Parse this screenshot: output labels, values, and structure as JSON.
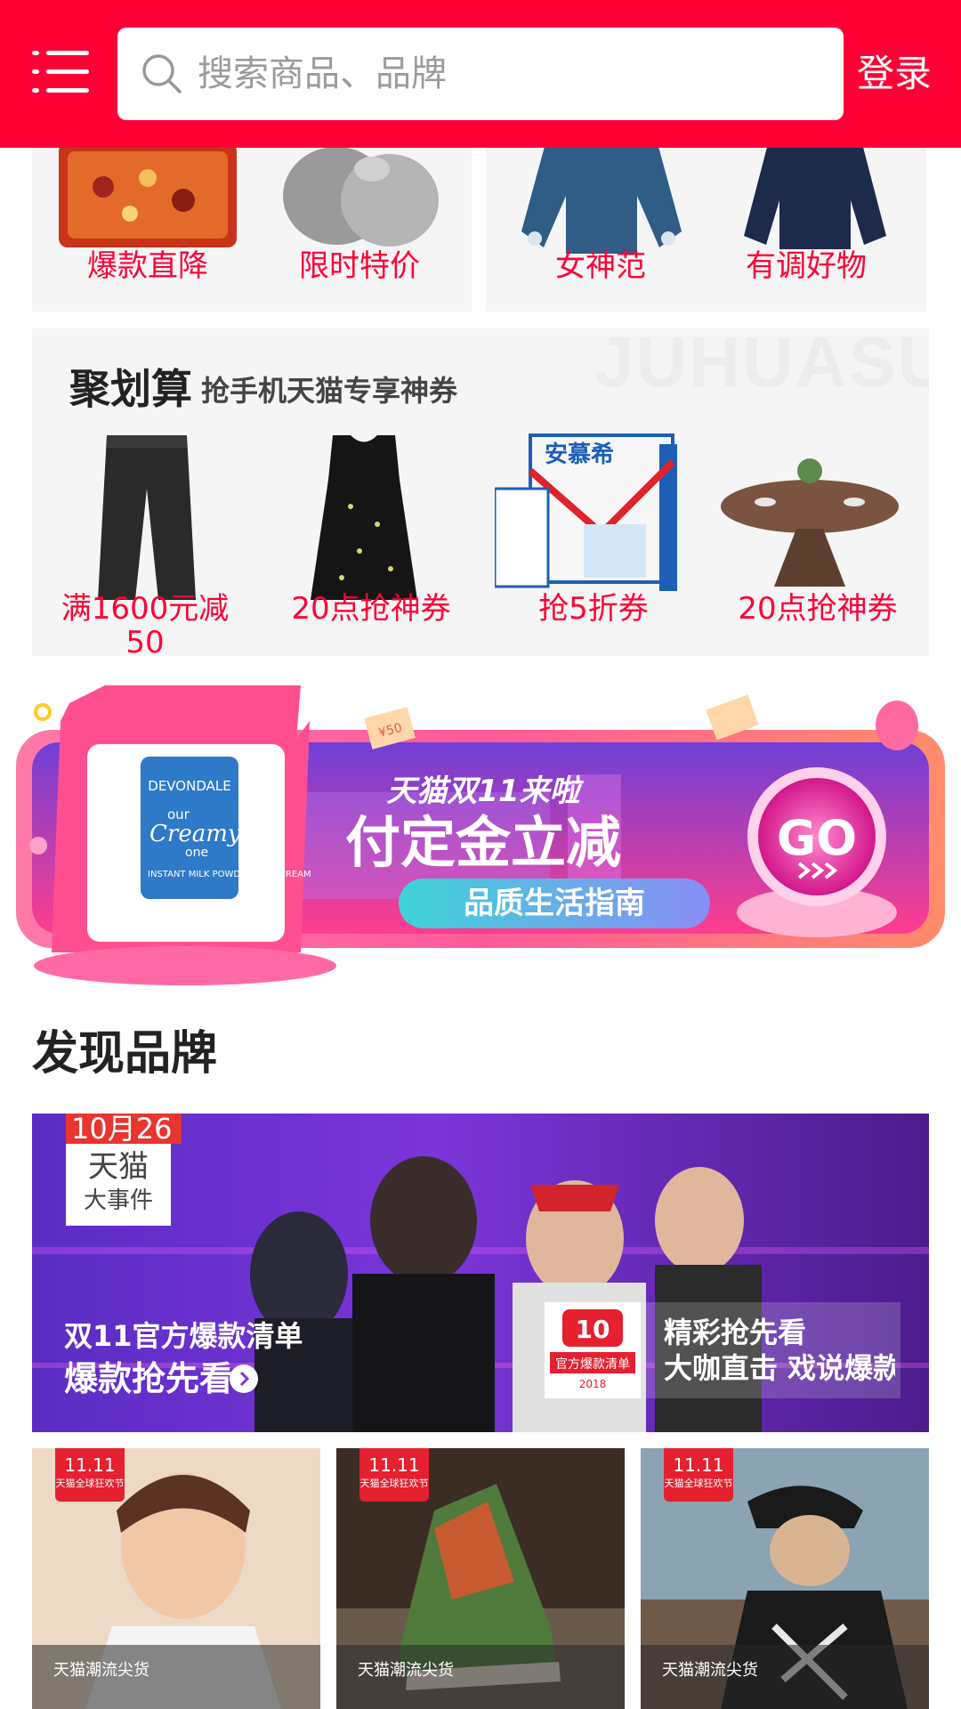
{
  "header": {
    "search_placeholder": "搜索商品、品牌",
    "login_label": "登录"
  },
  "top_cards": {
    "left": [
      "爆款直降",
      "限时特价"
    ],
    "right": [
      "女神范",
      "有调好物"
    ]
  },
  "juhuasuan": {
    "watermark": "JUHUASUAN",
    "title": "聚划算",
    "subtitle": "抢手机天猫专享神券",
    "items": [
      {
        "label": "满1600元减50"
      },
      {
        "label": "20点抢神券"
      },
      {
        "label": "抢5折券",
        "product_text": "安慕希"
      },
      {
        "label": "20点抢神券"
      }
    ]
  },
  "promo_banner": {
    "headline_small": "天猫双11来啦",
    "headline_big": "付定金立减",
    "pill": "品质生活指南",
    "go": "GO",
    "coupon": "¥50",
    "product_brand": "DEVONDALE",
    "product_name_1": "our",
    "product_name_2": "Creamy",
    "product_name_3": "one",
    "product_desc": "INSTANT MILK POWDER FULL CREAM"
  },
  "discover": {
    "title": "发现品牌",
    "banner": {
      "date": "10月26",
      "tag_line1": "天猫",
      "tag_line2": "大事件",
      "line1": "双11官方爆款清单",
      "line2": "爆款抢先看",
      "card_title": "精彩抢先看",
      "card_sub": "大咖直击 戏说爆款",
      "card_logo_text": "官方爆款清单",
      "card_logo_year": "2018"
    },
    "tiles": [
      {
        "badge": "11.11",
        "badge_sub": "天猫全球狂欢节",
        "footer": "天猫潮流尖货"
      },
      {
        "badge": "11.11",
        "badge_sub": "天猫全球狂欢节",
        "footer": "天猫潮流尖货"
      },
      {
        "badge": "11.11",
        "badge_sub": "天猫全球狂欢节",
        "footer": "天猫潮流尖货"
      }
    ]
  },
  "colors": {
    "brand_red": "#ff0036",
    "card_bg": "#f5f5f5"
  }
}
